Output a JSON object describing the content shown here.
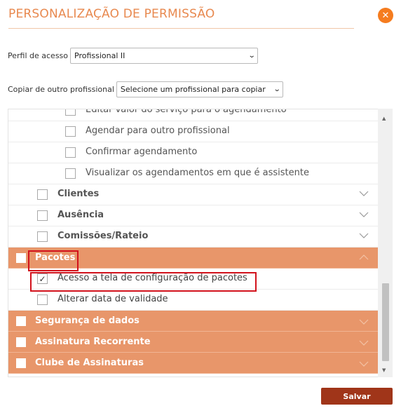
{
  "header": {
    "title": "PERSONALIZAÇÃO DE PERMISSÃO",
    "close_glyph": "✕"
  },
  "form": {
    "profile_label": "Perfil de acesso",
    "profile_value": "Profissional II",
    "copy_label": "Copiar de outro profissional",
    "copy_value": "Selecione um profissional para copiar"
  },
  "permissions": {
    "agenda_items": [
      {
        "label": "Editar valor do serviço para o agendamento",
        "checked": false
      },
      {
        "label": "Agendar para outro profissional",
        "checked": false
      },
      {
        "label": "Confirmar agendamento",
        "checked": false
      },
      {
        "label": "Visualizar os agendamentos em que é assistente",
        "checked": false
      }
    ],
    "modules": [
      {
        "label": "Clientes",
        "checked": false
      },
      {
        "label": "Ausência",
        "checked": false
      },
      {
        "label": "Comissões/Rateio",
        "checked": false
      }
    ],
    "pacotes": {
      "label": "Pacotes",
      "checked": false,
      "items": [
        {
          "label": "Acesso a tela de configuração de pacotes",
          "checked": true
        },
        {
          "label": "Alterar data de validade",
          "checked": false
        }
      ]
    },
    "categories": [
      {
        "label": "Segurança de dados",
        "checked": false
      },
      {
        "label": "Assinatura Recorrente",
        "checked": false
      },
      {
        "label": "Clube de Assinaturas",
        "checked": false
      }
    ]
  },
  "footer": {
    "save_label": "Salvar"
  },
  "colors": {
    "accent": "#e8894f",
    "category_bg": "#e8966a",
    "save_bg": "#a03519",
    "highlight": "#d2121c"
  }
}
